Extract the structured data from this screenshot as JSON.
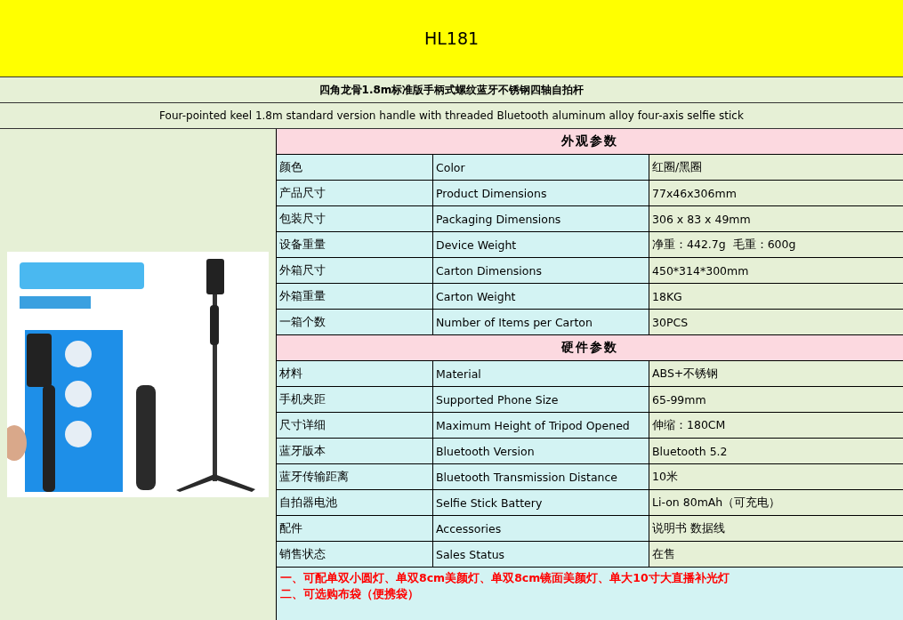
{
  "title": "HL181",
  "subtitle_cn": "四角龙骨1.8m标准版手柄式螺纹蓝牙不锈钢四轴自拍杆",
  "subtitle_en": "Four-pointed keel 1.8m standard version handle with threaded Bluetooth aluminum alloy four-axis selfie stick",
  "sections": [
    {
      "heading": "外观参数",
      "rows": [
        {
          "label_cn": "颜色",
          "label_en": "Color",
          "value": "红圈/黑圈"
        },
        {
          "label_cn": "产品尺寸",
          "label_en": "Product Dimensions",
          "value": "77x46x306mm"
        },
        {
          "label_cn": "包装尺寸",
          "label_en": "Packaging Dimensions",
          "value": "306 x 83 x 49mm"
        },
        {
          "label_cn": "设备重量",
          "label_en": "Device Weight",
          "value": "净重：442.7g  毛重：600g"
        },
        {
          "label_cn": "外箱尺寸",
          "label_en": "Carton Dimensions",
          "value": "450*314*300mm"
        },
        {
          "label_cn": "外箱重量",
          "label_en": "Carton Weight",
          "value": "18KG"
        },
        {
          "label_cn": "一箱个数",
          "label_en": "Number of Items per Carton",
          "value": "30PCS"
        }
      ]
    },
    {
      "heading": "硬件参数",
      "rows": [
        {
          "label_cn": "材料",
          "label_en": "Material",
          "value": "ABS+不锈钢"
        },
        {
          "label_cn": "手机夹距",
          "label_en": "Supported Phone Size",
          "value": "65-99mm"
        },
        {
          "label_cn": "尺寸详细",
          "label_en": "Maximum Height of Tripod Opened",
          "value": "伸缩：180CM"
        },
        {
          "label_cn": "蓝牙版本",
          "label_en": "Bluetooth Version",
          "value": "Bluetooth 5.2"
        },
        {
          "label_cn": "蓝牙传输距离",
          "label_en": "Bluetooth Transmission Distance",
          "value": "10米"
        },
        {
          "label_cn": "自拍器电池",
          "label_en": "Selfie Stick Battery",
          "value": "Li-on 80mAh（可充电）"
        },
        {
          "label_cn": "配件",
          "label_en": "Accessories",
          "value": "说明书 数据线"
        },
        {
          "label_cn": "销售状态",
          "label_en": "Sales Status",
          "value": "在售"
        }
      ]
    }
  ],
  "notes": [
    "一、可配单双小圆灯、单双8cm美颜灯、单双8cm镜面美颜灯、单大10寸大直播补光灯",
    "二、可选购布袋（便携袋）"
  ]
}
